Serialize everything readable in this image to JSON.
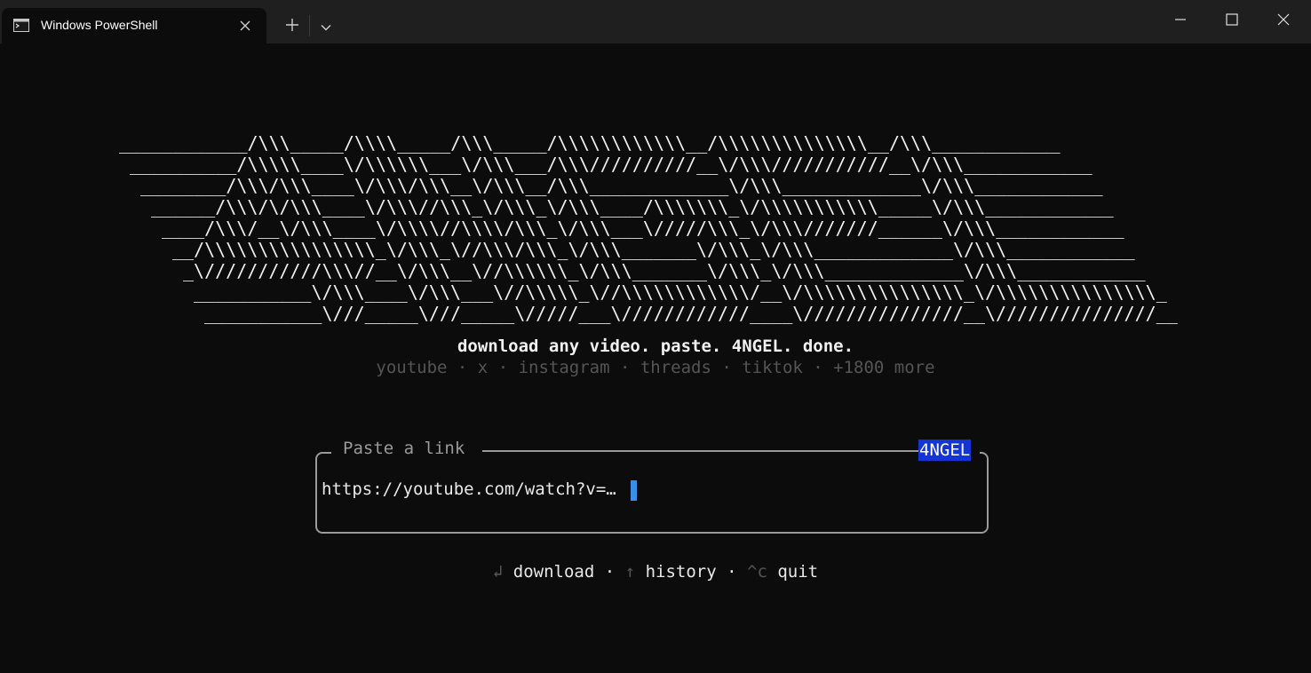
{
  "window": {
    "tab_title": "Windows PowerShell"
  },
  "icons": {
    "tab": "terminal-icon",
    "close_tab": "close-icon",
    "new_tab": "plus-icon",
    "dropdown": "chevron-down-icon",
    "minimize": "minimize-icon",
    "maximize": "maximize-icon",
    "close_window": "close-icon"
  },
  "banner": {
    "lines": [
      "____________/\\\\\\_____/\\\\\\\\_____/\\\\\\_____/\\\\\\\\\\\\\\\\\\\\\\\\__/\\\\\\\\\\\\\\\\\\\\\\\\\\\\__/\\\\\\____________",
      "__________/\\\\\\\\\\____\\/\\\\\\\\\\\\___\\/\\\\\\___/\\\\\\//////////__\\/\\\\\\///////////__\\/\\\\\\____________",
      "________/\\\\\\/\\\\\\____\\/\\\\\\/\\\\\\__\\/\\\\\\__/\\\\\\_____________\\/\\\\\\_____________\\/\\\\\\____________",
      "______/\\\\\\/\\/\\\\\\____\\/\\\\\\//\\\\\\_\\/\\\\\\_\\/\\\\\\____/\\\\\\\\\\\\\\_\\/\\\\\\\\\\\\\\\\\\\\\\_____\\/\\\\\\____________",
      "____/\\\\\\/__\\/\\\\\\____\\/\\\\\\\\//\\\\\\\\/\\\\\\_\\/\\\\\\___\\/////\\\\\\_\\/\\\\\\///////______\\/\\\\\\____________",
      "__/\\\\\\\\\\\\\\\\\\\\\\\\\\\\\\\\_\\/\\\\\\_\\//\\\\\\/\\\\\\_\\/\\\\\\_______\\/\\\\\\_\\/\\\\\\_____________\\/\\\\\\____________",
      "_\\///////////\\\\\\//__\\/\\\\\\__\\//\\\\\\\\\\\\_\\/\\\\\\_______\\/\\\\\\_\\/\\\\\\_____________\\/\\\\\\____________",
      "___________\\/\\\\\\____\\/\\\\\\___\\//\\\\\\\\\\_\\//\\\\\\\\\\\\\\\\\\\\\\\\/__\\/\\\\\\\\\\\\\\\\\\\\\\\\\\\\\\_\\/\\\\\\\\\\\\\\\\\\\\\\\\\\\\\\_",
      "___________\\///_____\\///_____\\/////___\\////////////____\\///////////////__\\///////////////__"
    ]
  },
  "tagline": "download any video. paste. 4NGEL. done.",
  "platforms": "youtube · x · instagram · threads · tiktok · +1800 more",
  "input": {
    "title": "Paste a link",
    "badge": "4NGEL",
    "value": "https://youtube.com/watch?v=…"
  },
  "hints": {
    "download_key": "↲",
    "download_label": "download",
    "sep1": "·",
    "history_key": "↑",
    "history_label": "history",
    "sep2": "·",
    "quit_key": "^c",
    "quit_label": "quit"
  }
}
